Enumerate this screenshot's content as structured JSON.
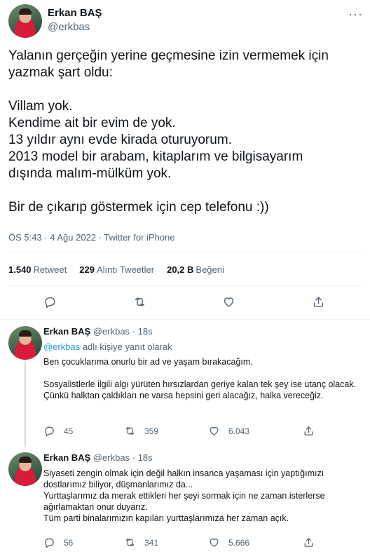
{
  "tweet": {
    "author_name": "Erkan BAŞ",
    "author_handle": "@erkbas",
    "more_label": "···",
    "text": "Yalanın gerçeğin yerine geçmesine izin vermemek için\nyazmak şart oldu:\n\nVillam yok.\nKendime ait bir evim de yok.\n13 yıldır aynı evde kirada oturuyorum.\n2013 model bir arabam, kitaplarım ve bilgisayarım\ndışında malım-mülküm yok.\n\nBir de çıkarıp göstermek için cep telefonu :))",
    "timestamp": "ÖS 5:43 · 4 Ağu 2022 · Twitter for iPhone",
    "stats": [
      {
        "count": "1.540",
        "label": "Retweet"
      },
      {
        "count": "229",
        "label": "Alıntı Tweetler"
      },
      {
        "count": "20,2 B",
        "label": "Beğeni"
      }
    ]
  },
  "replies": [
    {
      "author_name": "Erkan BAŞ",
      "author_handle": "@erkbas",
      "time": "· 18s",
      "replying_prefix": "@erkbas",
      "replying_suffix": " adlı kişiye yanıt olarak",
      "text": "Ben çocuklarıma onurlu bir ad ve yaşam bırakacağım.\n\nSosyalistlerle ilgili algı yürüten hırsızlardan geriye kalan tek şey ise utanç olacak.\nÇünkü halktan çaldıkları ne varsa hepsini geri alacağız, halka vereceğiz.",
      "replies_count": "45",
      "retweets_count": "359",
      "likes_count": "6.043"
    },
    {
      "author_name": "Erkan BAŞ",
      "author_handle": "@erkbas",
      "time": "· 18s",
      "text": "Siyaseti zengin olmak için değil halkın insanca yaşaması için yaptığımızı dostlarımız biliyor, düşmanlarımız da...\nYurttaşlarımız da merak ettikleri her şeyi sormak için ne zaman isterlerse ağırlamaktan onur duyarız.\nTüm parti binalarımızın kapıları yurttaşlarımıza her zaman açık.",
      "replies_count": "56",
      "retweets_count": "341",
      "likes_count": "5.666"
    }
  ]
}
